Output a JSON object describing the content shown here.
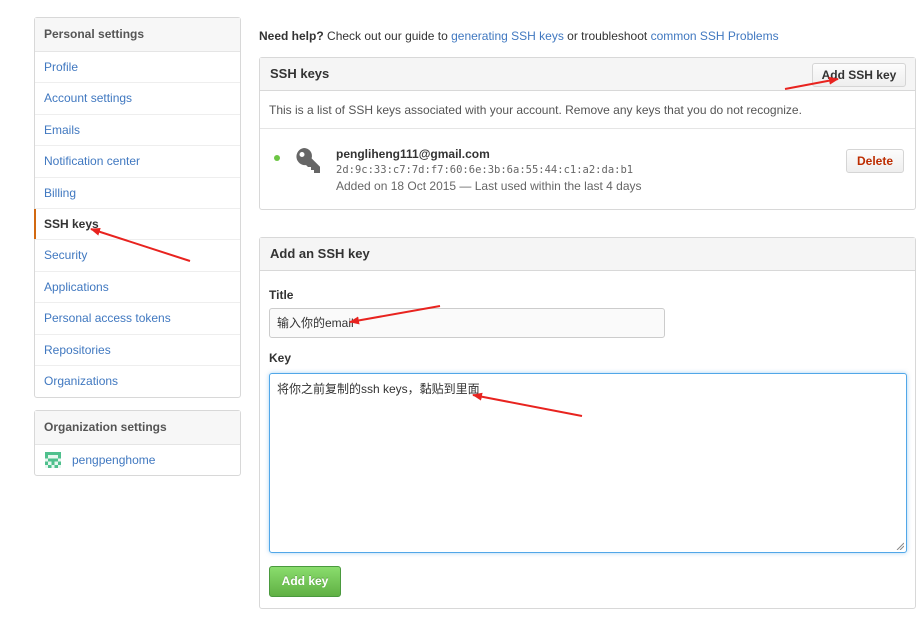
{
  "sidebar": {
    "heading": "Personal settings",
    "items": [
      {
        "label": "Profile",
        "selected": false
      },
      {
        "label": "Account settings",
        "selected": false
      },
      {
        "label": "Emails",
        "selected": false
      },
      {
        "label": "Notification center",
        "selected": false
      },
      {
        "label": "Billing",
        "selected": false
      },
      {
        "label": "SSH keys",
        "selected": true
      },
      {
        "label": "Security",
        "selected": false
      },
      {
        "label": "Applications",
        "selected": false
      },
      {
        "label": "Personal access tokens",
        "selected": false
      },
      {
        "label": "Repositories",
        "selected": false
      },
      {
        "label": "Organizations",
        "selected": false
      }
    ],
    "selected_accent": "#d26911"
  },
  "org_settings": {
    "heading": "Organization settings",
    "org_name": "pengpenghome",
    "avatar_icon": "identicon-avatar"
  },
  "help": {
    "bold": "Need help?",
    "text1": " Check out our guide to ",
    "link1": "generating SSH keys",
    "text2": " or troubleshoot ",
    "link2": "common SSH Problems"
  },
  "ssh_keys": {
    "header": "SSH keys",
    "add_button": "Add SSH key",
    "intro": "This is a list of SSH keys associated with your account. Remove any keys that you do not recognize.",
    "keys": [
      {
        "title": "pengliheng111@gmail.com",
        "fingerprint": "2d:9c:33:c7:7d:f7:60:6e:3b:6a:55:44:c1:a2:da:b1",
        "added": "Added on 18 Oct 2015 — Last used within the last 4 days",
        "status_color": "#6cc644",
        "delete_label": "Delete",
        "icon": "key-icon"
      }
    ]
  },
  "add_key": {
    "header": "Add an SSH key",
    "title_label": "Title",
    "title_value": "输入你的email",
    "key_label": "Key",
    "key_value": "将你之前复制的ssh keys，黏贴到里面",
    "submit_label": "Add key"
  },
  "colors": {
    "link": "#4078c0",
    "annotation": "#e8231f",
    "button_green": "#60b044"
  }
}
